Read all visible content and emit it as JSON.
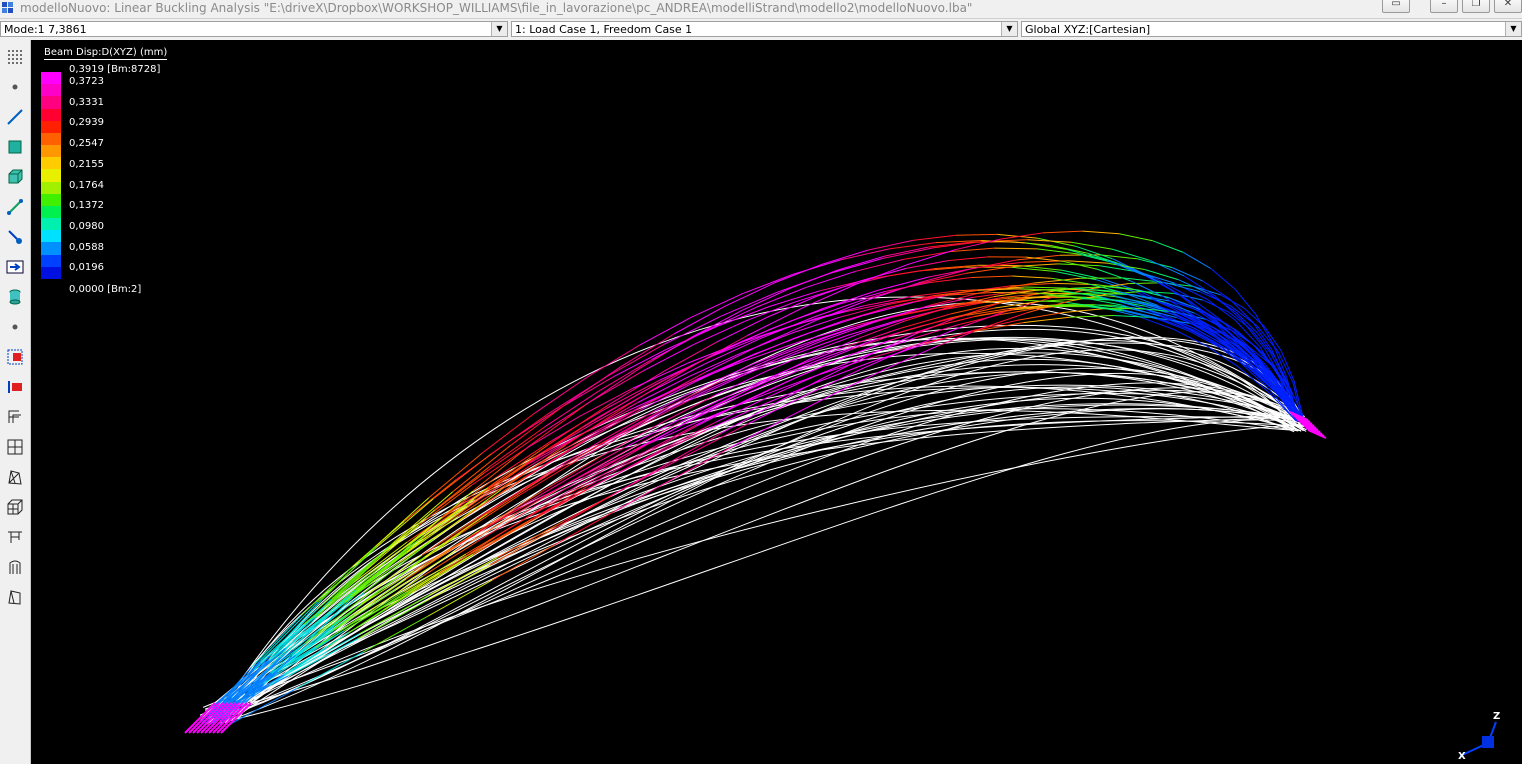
{
  "window": {
    "title": "modelloNuovo: Linear Buckling Analysis \"E:\\driveX\\Dropbox\\WORKSHOP_WILLIAMS\\file_in_lavorazione\\pc_ANDREA\\modelliStrand\\modello2\\modelloNuovo.lba\"",
    "minimize": "–",
    "restore": "❐",
    "close": "✕"
  },
  "combos": {
    "mode": "Mode:1  7,3861",
    "load_case": "1: Load Case 1, Freedom Case 1",
    "coord_system": "Global XYZ:[Cartesian]"
  },
  "toolbar_icons": [
    "grid-dots-icon",
    "node-icon",
    "beam-icon",
    "plate-icon",
    "brick-icon",
    "link-icon",
    "restraint-icon",
    "load-arrow-icon",
    "cylinder-icon",
    "point-icon",
    "attribute-select-icon",
    "element-select-icon",
    "beam-properties-icon",
    "wireframe-view-icon",
    "perspective-view-icon",
    "solid-view-icon",
    "truss-icon",
    "shell-view-icon",
    "plate-view-icon"
  ],
  "legend": {
    "title": "Beam Disp:D(XYZ) (mm)",
    "max_label": "0,3919 [Bm:8728]",
    "min_label": "0,0000 [Bm:2]",
    "labels": [
      "0,3723",
      "0,3331",
      "0,2939",
      "0,2547",
      "0,2155",
      "0,1764",
      "0,1372",
      "0,0980",
      "0,0588",
      "0,0196"
    ],
    "colors": [
      "#ff00ff",
      "#ff00c8",
      "#ff0080",
      "#ff0030",
      "#ff2000",
      "#ff6000",
      "#ff9800",
      "#ffcc00",
      "#e8f000",
      "#a0f000",
      "#40f000",
      "#00f050",
      "#00f0b0",
      "#00e0ff",
      "#0090ff",
      "#0040ff",
      "#0010e0"
    ]
  },
  "triad": {
    "z": "Z",
    "x": "X"
  },
  "colors": {
    "background": "#000000",
    "undeformed": "#ffffff",
    "support": "#ff00ff"
  }
}
